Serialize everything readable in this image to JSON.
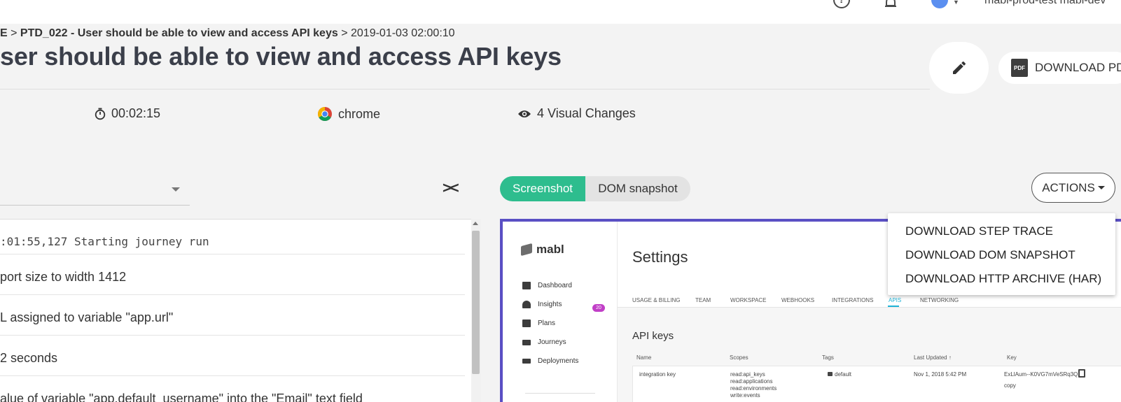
{
  "topbar": {
    "help_icon": "?",
    "user_name": "mabl-prod-test mabl-dev"
  },
  "breadcrumb": {
    "part1": "E",
    "sep1": ">",
    "part2": "PTD_022 - User should be able to view and access API keys",
    "sep2": ">",
    "part3": "2019-01-03 02:00:10"
  },
  "page_title": "ser should be able to view and access API keys",
  "buttons": {
    "download_pdf": "DOWNLOAD PD",
    "pdf_icon_text": "PDF"
  },
  "meta": {
    "duration": "00:02:15",
    "browser": "chrome",
    "visual_changes": "4 Visual Changes"
  },
  "log": {
    "lines": [
      ":01:55,127 Starting journey run",
      "port size to width 1412",
      "L assigned to variable \"app.url\"",
      "2 seconds",
      "alue of variable \"app.default_username\" into the \"Email\" text field"
    ]
  },
  "view_toggle": {
    "screenshot": "Screenshot",
    "dom_snapshot": "DOM snapshot"
  },
  "actions": {
    "label": "ACTIONS",
    "menu": [
      "DOWNLOAD STEP TRACE",
      "DOWNLOAD DOM SNAPSHOT",
      "DOWNLOAD HTTP ARCHIVE (HAR)"
    ]
  },
  "screenshot": {
    "logo": "mabl",
    "nav": [
      "Dashboard",
      "Insights",
      "Plans",
      "Journeys",
      "Deployments"
    ],
    "insights_badge": "20",
    "settings_title": "Settings",
    "tabs": [
      "USAGE & BILLING",
      "TEAM",
      "WORKSPACE",
      "WEBHOOKS",
      "INTEGRATIONS",
      "APIS",
      "NETWORKING"
    ],
    "api_keys_title": "API keys",
    "columns": [
      "Name",
      "Scopes",
      "Tags",
      "Last Updated ↑",
      "Key"
    ],
    "row": {
      "name": "integration key",
      "scopes": [
        "read:api_keys",
        "read:applications",
        "read:environments",
        "write:events"
      ],
      "tag": "default",
      "updated": "Nov 1, 2018 5:42 PM",
      "key": "ExLlAum--K0VG7mVeSRq3Q",
      "copy": "copy"
    }
  },
  "colors": {
    "accent_green": "#2ebd8e",
    "screenshot_border": "#5a4fc4",
    "badge": "#c13fc7",
    "tab_active": "#1eb3d6"
  }
}
